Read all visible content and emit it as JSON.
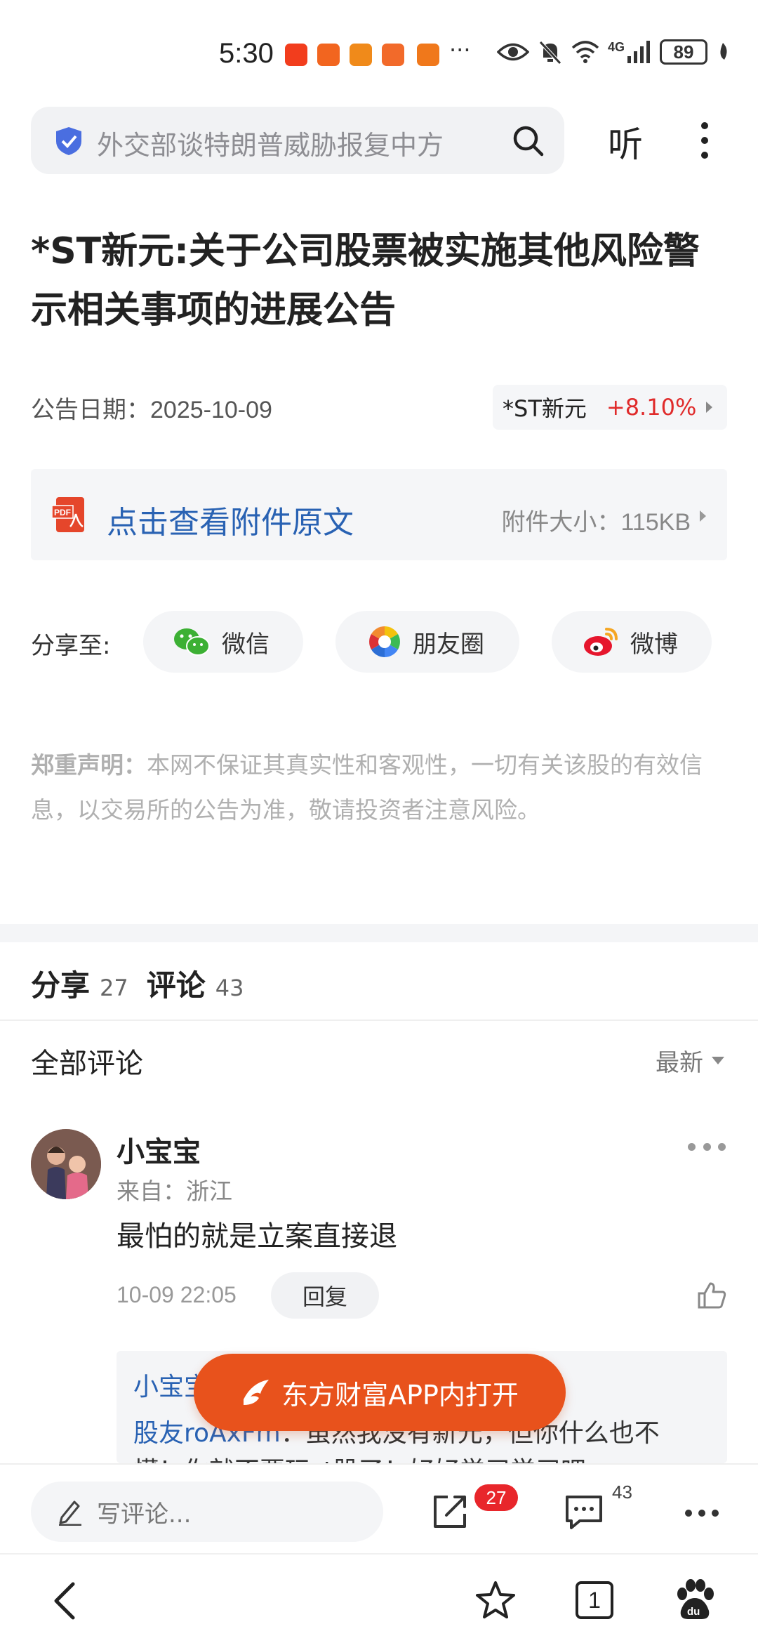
{
  "status_bar": {
    "time": "5:30",
    "more": "···",
    "network": "4G",
    "battery": "89"
  },
  "search": {
    "query": "外交部谈特朗普威胁报复中方",
    "listen_label": "听"
  },
  "article": {
    "title": "*ST新元:关于公司股票被实施其他风险警示相关事项的进展公告",
    "date_label": "公告日期：",
    "date": "2025-10-09",
    "stock_name": "*ST新元",
    "stock_change": "+8.10%",
    "attachment_link": "点击查看附件原文",
    "attachment_size_label": "附件大小：",
    "attachment_size": "115KB"
  },
  "share": {
    "label": "分享至:",
    "targets": [
      "微信",
      "朋友圈",
      "微博"
    ]
  },
  "disclaimer": {
    "label": "郑重声明：",
    "text": "本网不保证其真实性和客观性，一切有关该股的有效信息，以交易所的公告为准，敬请投资者注意风险。"
  },
  "stats": {
    "share_label": "分享",
    "share_count": "27",
    "comment_label": "评论",
    "comment_count": "43"
  },
  "comments_header": {
    "title": "全部评论",
    "sort": "最新"
  },
  "comment": {
    "user": "小宝宝",
    "from": "来自：浙江",
    "text": "最怕的就是立案直接退",
    "time": "10-09 22:05",
    "reply_label": "回复",
    "reply_line1": "小宝宝",
    "reply_user": "股友roAxFm",
    "reply_line2": "：虽然我没有新元，但你什么也不",
    "reply_line3": "懂！你就不要玩st股了！好好学习学习吧"
  },
  "open_app": {
    "label": "东方财富APP内打开"
  },
  "toolbar": {
    "write_placeholder": "写评论...",
    "share_badge": "27",
    "comment_count": "43"
  },
  "navbar": {
    "tab_count": "1"
  },
  "colors": {
    "accent_orange": "#e8521c",
    "link_blue": "#2962b3",
    "up_red": "#e02b2b",
    "badge_red": "#e8262b"
  }
}
